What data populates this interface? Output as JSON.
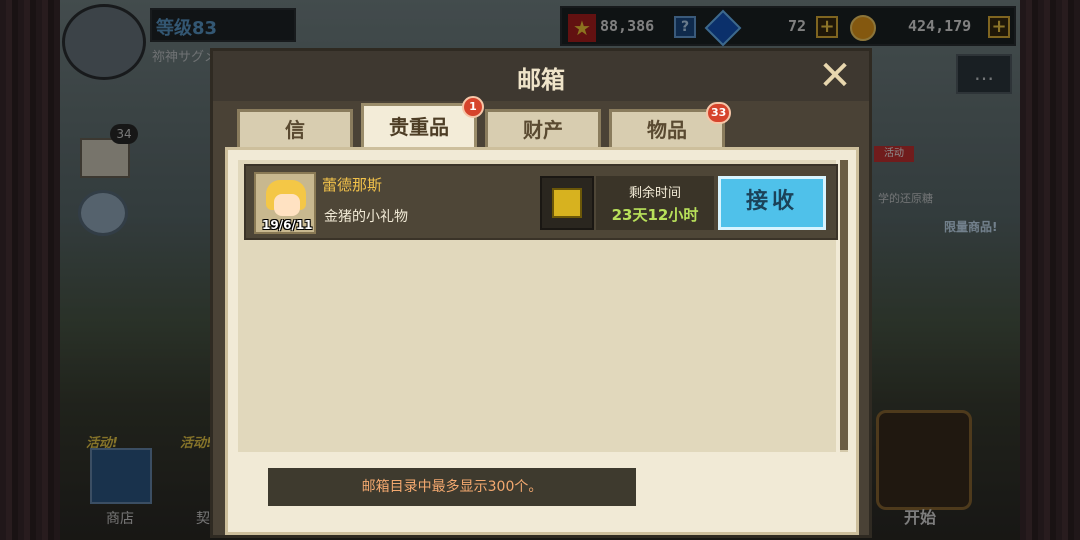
{
  "player": {
    "level": "等级83",
    "name": "祢神サグメ"
  },
  "currency": {
    "medals": "88,386",
    "gems": "72",
    "gold": "424,179"
  },
  "side": {
    "mail_count": "34",
    "event_tag": "活动!",
    "shop_label": "商店",
    "contract_label": "契约",
    "start_label": "开始",
    "limited_label": "限量商品!",
    "restore_text": "学的还原糖",
    "activity_badge": "活动"
  },
  "dialog": {
    "title": "邮箱",
    "tabs": [
      {
        "label": "信",
        "badge": ""
      },
      {
        "label": "贵重品",
        "badge": "1"
      },
      {
        "label": "财产",
        "badge": ""
      },
      {
        "label": "物品",
        "badge": "33"
      }
    ],
    "active_tab": "贵重品",
    "mail": {
      "sender": "蕾德那斯",
      "subject": "金猪的小礼物",
      "date": "19/6/11",
      "remain_label": "剩余时间",
      "remain_value": "23天12小时",
      "receive_label": "接收"
    },
    "notice": "邮箱目录中最多显示300个。"
  },
  "colors": {
    "accent_blue": "#4fc1ea",
    "sender_gold": "#f1c14a",
    "time_green": "#b8e05a",
    "badge_red": "#d6442c"
  }
}
